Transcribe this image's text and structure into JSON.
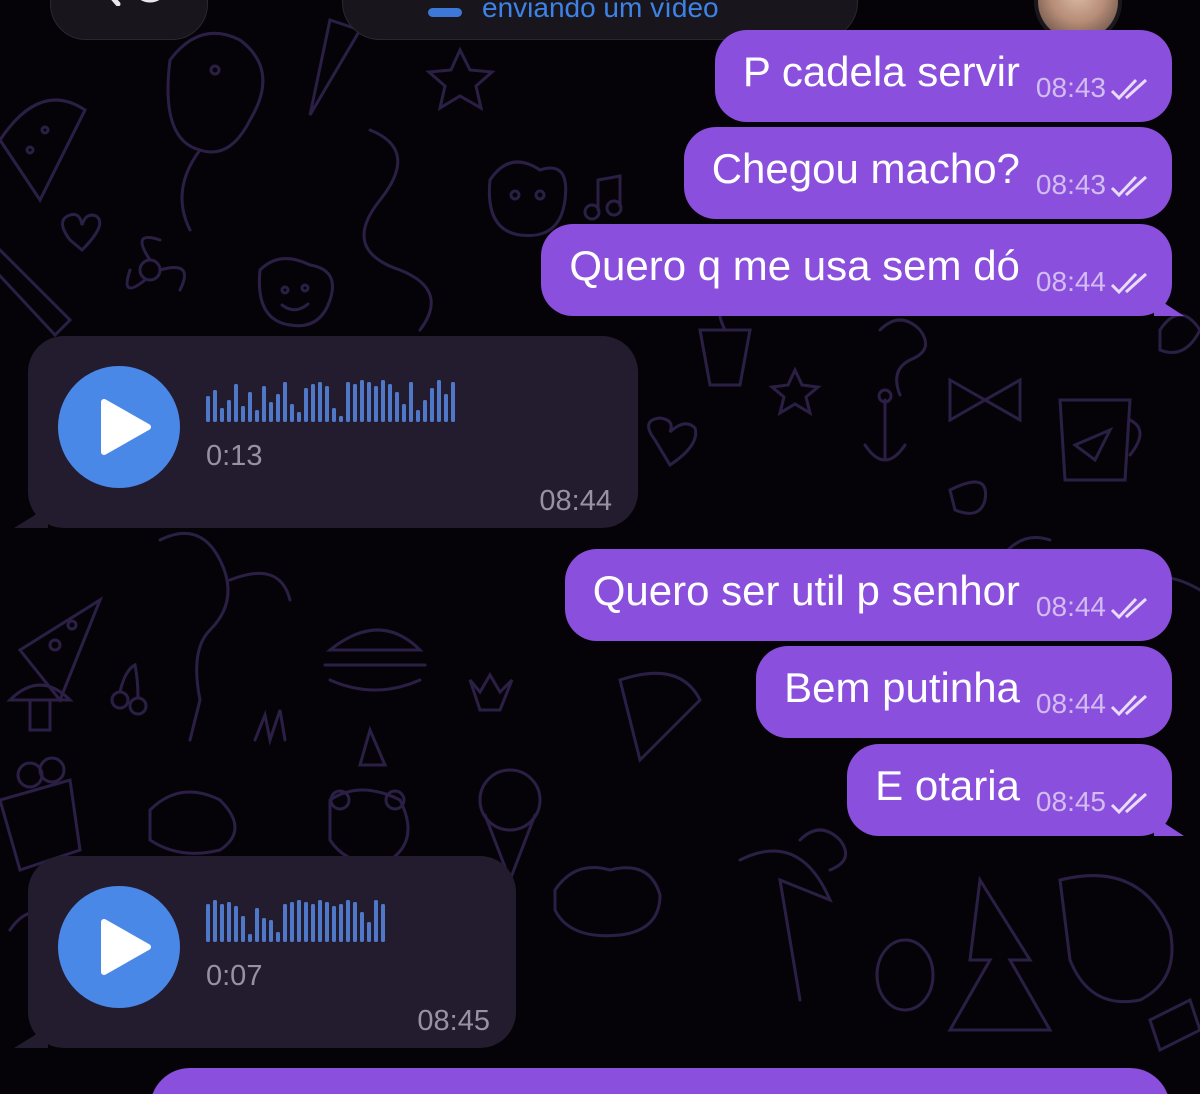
{
  "header": {
    "status_text": "enviando um vídeo",
    "back_icon": "chevron-left-icon",
    "avatar": "contact-avatar"
  },
  "messages": [
    {
      "type": "text",
      "direction": "out",
      "text": "P cadela servir",
      "time": "08:43",
      "status": "read"
    },
    {
      "type": "text",
      "direction": "out",
      "text": "Chegou macho?",
      "time": "08:43",
      "status": "read"
    },
    {
      "type": "text",
      "direction": "out",
      "text": "Quero q me usa sem dó",
      "time": "08:44",
      "status": "read"
    },
    {
      "type": "voice",
      "direction": "in",
      "duration": "0:13",
      "time": "08:44"
    },
    {
      "type": "text",
      "direction": "out",
      "text": "Quero ser util p senhor",
      "time": "08:44",
      "status": "read"
    },
    {
      "type": "text",
      "direction": "out",
      "text": "Bem putinha",
      "time": "08:44",
      "status": "read"
    },
    {
      "type": "text",
      "direction": "out",
      "text": "E otaria",
      "time": "08:45",
      "status": "read"
    },
    {
      "type": "voice",
      "direction": "in",
      "duration": "0:07",
      "time": "08:45"
    }
  ],
  "colors": {
    "outgoing_bubble": "#8a4fdc",
    "incoming_bubble": "#231b2e",
    "play_button": "#4a88e8",
    "waveform": "#4f78c8",
    "background": "#050308",
    "doodle": "#2c1f45"
  }
}
